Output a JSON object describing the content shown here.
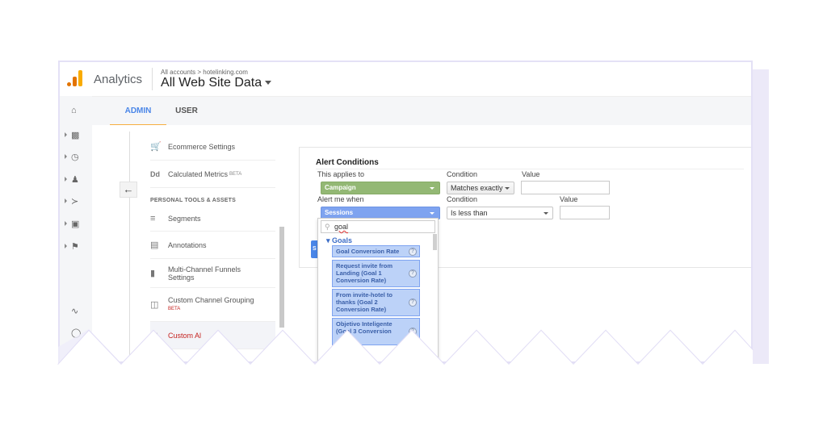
{
  "header": {
    "app_name": "Analytics",
    "breadcrumb": "All accounts > hotelinking.com",
    "property": "All Web Site Data"
  },
  "tabs": [
    {
      "label": "ADMIN",
      "active": true
    },
    {
      "label": "USER",
      "active": false
    }
  ],
  "left_nav": {
    "icons": [
      "home-icon",
      "dashboard-icon",
      "clock-icon",
      "person-icon",
      "acquisition-icon",
      "behavior-icon",
      "flag-icon",
      "discover-icon",
      "lightbulb-icon"
    ]
  },
  "admin_menu": {
    "items": [
      {
        "label": "Ecommerce Settings",
        "icon": "cart-icon"
      },
      {
        "label": "Calculated Metrics",
        "badge": "BETA",
        "icon": "dd-icon",
        "icon_text": "Dd"
      }
    ],
    "section_header": "PERSONAL TOOLS & ASSETS",
    "personal_items": [
      {
        "label": "Segments",
        "icon": "segments-icon"
      },
      {
        "label": "Annotations",
        "icon": "annotation-icon"
      },
      {
        "label": "Multi-Channel Funnels Settings",
        "icon": "bar-chart-icon"
      },
      {
        "label": "Custom Channel Grouping",
        "badge": "BETA",
        "icon": "channel-icon"
      },
      {
        "label": "Custom Al",
        "icon": "megaphone-icon",
        "active": true
      }
    ]
  },
  "alert_conditions": {
    "title": "Alert Conditions",
    "applies_to_label": "This applies to",
    "applies_to_value": "Campaign",
    "condition_label": "Condition",
    "condition1_value": "Matches exactly",
    "value_label": "Value",
    "value1": "",
    "alert_when_label": "Alert me when",
    "alert_when_value": "Sessions",
    "condition2_value": "Is less than",
    "value2": "",
    "save_label": "S"
  },
  "metric_dropdown": {
    "search_value": "goal",
    "group": "Goals",
    "options": [
      "Goal Conversion Rate",
      "Request invite from Landing (Goal 1 Conversion Rate)",
      "From invite-hotel to thanks (Goal 2 Conversion Rate)",
      "Objetivo Inteligente (Goal 3 Conversion"
    ]
  },
  "colors": {
    "accent_blue": "#4a86e8",
    "tab_underline": "#f6ae40",
    "segment_green": "#93b874",
    "metric_blue": "#7ea3f0",
    "deco_lavender": "#e4e1f6"
  }
}
